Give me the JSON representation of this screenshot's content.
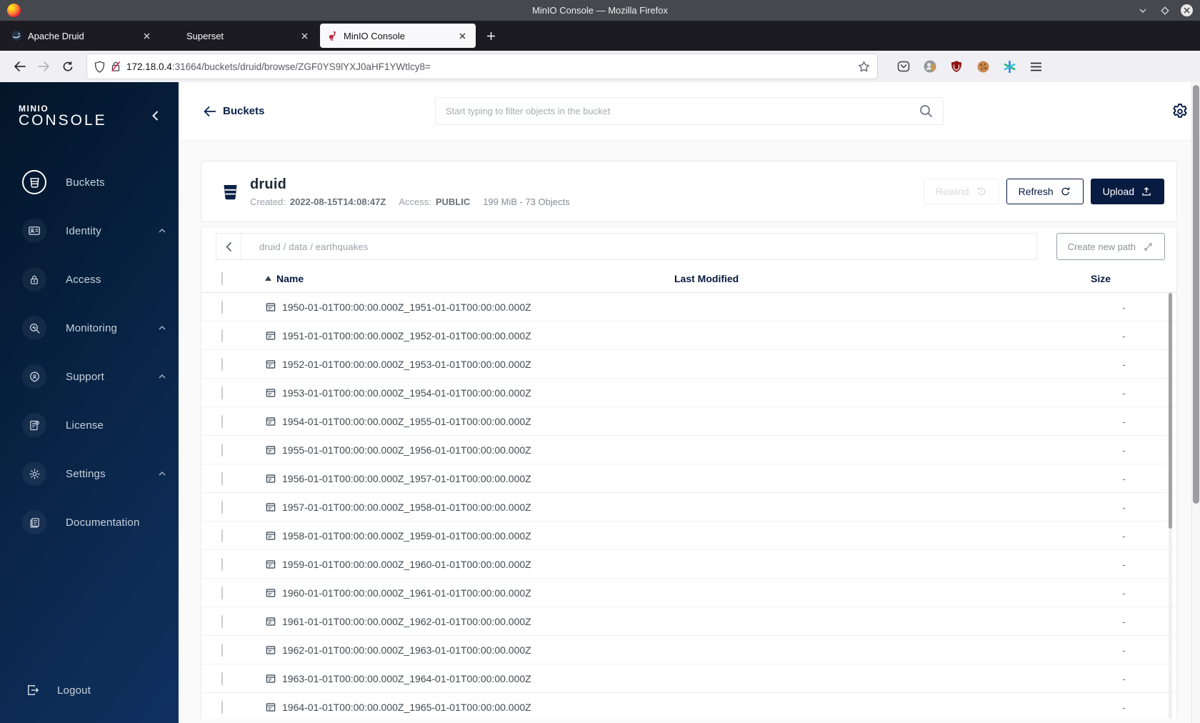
{
  "titlebar": {
    "title": "MinIO Console — Mozilla Firefox"
  },
  "tabs": {
    "items": [
      {
        "label": "Apache Druid",
        "active": false
      },
      {
        "label": "Superset",
        "active": false
      },
      {
        "label": "MinIO Console",
        "active": true
      }
    ]
  },
  "toolbar": {
    "url_host": "172.18.0.4",
    "url_path": ":31664/buckets/druid/browse/ZGF0YS9lYXJ0aHF1YWtlcy8="
  },
  "sidebar": {
    "logo_line1": "MINIO",
    "logo_line2": "CONSOLE",
    "items": [
      {
        "label": "Buckets",
        "icon": "bucket-icon",
        "active": true,
        "expandable": false
      },
      {
        "label": "Identity",
        "icon": "identity-icon",
        "active": false,
        "expandable": true
      },
      {
        "label": "Access",
        "icon": "lock-icon",
        "active": false,
        "expandable": false
      },
      {
        "label": "Monitoring",
        "icon": "monitoring-icon",
        "active": false,
        "expandable": true
      },
      {
        "label": "Support",
        "icon": "support-icon",
        "active": false,
        "expandable": true
      },
      {
        "label": "License",
        "icon": "license-icon",
        "active": false,
        "expandable": false
      },
      {
        "label": "Settings",
        "icon": "gear-icon",
        "active": false,
        "expandable": true
      },
      {
        "label": "Documentation",
        "icon": "documentation-icon",
        "active": false,
        "expandable": false
      }
    ],
    "logout_label": "Logout"
  },
  "header": {
    "back_label": "Buckets",
    "search_placeholder": "Start typing to filter objects in the bucket"
  },
  "bucket": {
    "name": "druid",
    "created_label": "Created:",
    "created_value": "2022-08-15T14:08:47Z",
    "access_label": "Access:",
    "access_value": "PUBLIC",
    "stats": "199 MiB - 73 Objects",
    "buttons": {
      "rewind": "Rewind",
      "refresh": "Refresh",
      "upload": "Upload"
    }
  },
  "browse": {
    "breadcrumb": "druid / data / earthquakes",
    "breadcrumb_segments": [
      "druid",
      "data",
      "earthquakes"
    ],
    "create_path_label": "Create new path"
  },
  "table": {
    "headers": {
      "name": "Name",
      "modified": "Last Modified",
      "size": "Size"
    },
    "rows": [
      {
        "name": "1950-01-01T00:00:00.000Z_1951-01-01T00:00:00.000Z",
        "modified": "",
        "size": "-"
      },
      {
        "name": "1951-01-01T00:00:00.000Z_1952-01-01T00:00:00.000Z",
        "modified": "",
        "size": "-"
      },
      {
        "name": "1952-01-01T00:00:00.000Z_1953-01-01T00:00:00.000Z",
        "modified": "",
        "size": "-"
      },
      {
        "name": "1953-01-01T00:00:00.000Z_1954-01-01T00:00:00.000Z",
        "modified": "",
        "size": "-"
      },
      {
        "name": "1954-01-01T00:00:00.000Z_1955-01-01T00:00:00.000Z",
        "modified": "",
        "size": "-"
      },
      {
        "name": "1955-01-01T00:00:00.000Z_1956-01-01T00:00:00.000Z",
        "modified": "",
        "size": "-"
      },
      {
        "name": "1956-01-01T00:00:00.000Z_1957-01-01T00:00:00.000Z",
        "modified": "",
        "size": "-"
      },
      {
        "name": "1957-01-01T00:00:00.000Z_1958-01-01T00:00:00.000Z",
        "modified": "",
        "size": "-"
      },
      {
        "name": "1958-01-01T00:00:00.000Z_1959-01-01T00:00:00.000Z",
        "modified": "",
        "size": "-"
      },
      {
        "name": "1959-01-01T00:00:00.000Z_1960-01-01T00:00:00.000Z",
        "modified": "",
        "size": "-"
      },
      {
        "name": "1960-01-01T00:00:00.000Z_1961-01-01T00:00:00.000Z",
        "modified": "",
        "size": "-"
      },
      {
        "name": "1961-01-01T00:00:00.000Z_1962-01-01T00:00:00.000Z",
        "modified": "",
        "size": "-"
      },
      {
        "name": "1962-01-01T00:00:00.000Z_1963-01-01T00:00:00.000Z",
        "modified": "",
        "size": "-"
      },
      {
        "name": "1963-01-01T00:00:00.000Z_1964-01-01T00:00:00.000Z",
        "modified": "",
        "size": "-"
      },
      {
        "name": "1964-01-01T00:00:00.000Z_1965-01-01T00:00:00.000Z",
        "modified": "",
        "size": "-"
      }
    ]
  },
  "colors": {
    "accent_navy": "#081C42",
    "sidebar_gradient_start": "#031528",
    "sidebar_gradient_end": "#0f3161",
    "minio_red": "#C72C48",
    "titlebar_gray": "#45484d",
    "tabbar_dark": "#1c1b22",
    "chrome_gray": "#f0f0f4"
  }
}
